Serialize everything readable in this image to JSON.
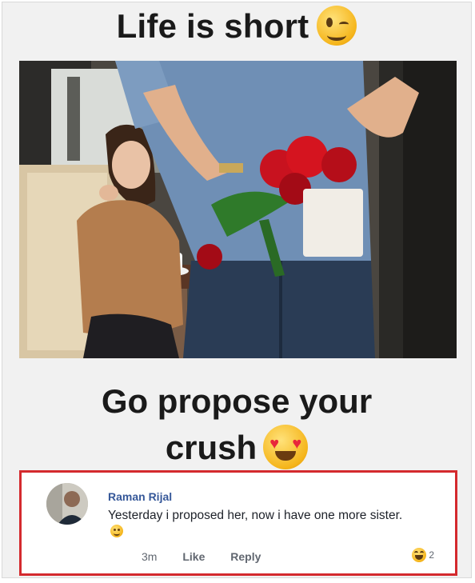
{
  "meme": {
    "top_text": "Life is short",
    "top_emoji": "winking-face",
    "bottom_text_line1": "Go propose your",
    "bottom_text_line2": "crush",
    "bottom_emoji": "heart-eyes-face"
  },
  "photo": {
    "subject": "woman-seated-at-cafe-table-and-man-holding-red-roses-behind-back"
  },
  "comment": {
    "author": "Raman Rijal",
    "text": "Yesterday i proposed her, now i have one more sister.",
    "emoji": "smiling-face",
    "time": "3m",
    "like_label": "Like",
    "reply_label": "Reply",
    "reaction_icon": "haha-reaction",
    "reaction_count": "2",
    "highlight_color": "#d42a2e"
  }
}
